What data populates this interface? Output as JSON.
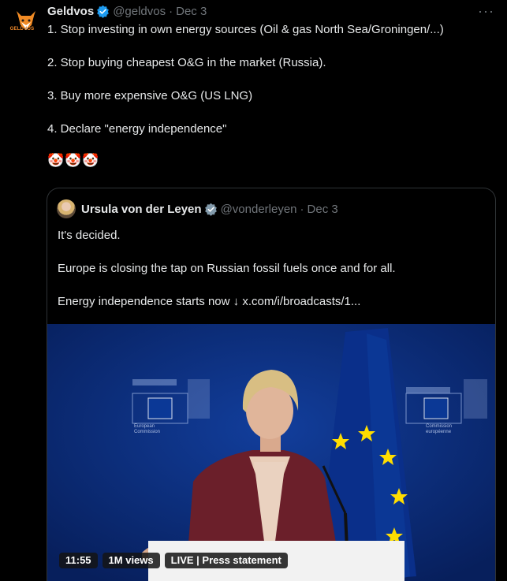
{
  "tweet": {
    "author_name": "Geldvos",
    "handle": "@geldvos",
    "separator": "·",
    "date": "Dec 3",
    "avatar_label": "GELDVOS",
    "more_label": "···",
    "lines": [
      "1. Stop investing in own energy sources (Oil & gas North Sea/Groningen/...)",
      "2. Stop buying cheapest O&G in the market (Russia).",
      "3. Buy more expensive O&G (US LNG)",
      "4. Declare \"energy independence\"",
      "🤡🤡🤡"
    ]
  },
  "quoted": {
    "author_name": "Ursula von der Leyen",
    "handle": "@vonderleyen",
    "separator": "·",
    "date": "Dec 3",
    "lines": [
      "It's decided.",
      "Europe is closing the tap on Russian fossil fuels once and for all."
    ],
    "last_line_prefix": "Energy independence starts now ↓ ",
    "link_text": "x.com/i/broadcasts/1..."
  },
  "video": {
    "duration": "11:55",
    "views": "1M views",
    "status": "LIVE | Press statement",
    "left_logo_text": "European\nCommission",
    "right_logo_text": "Commission\neuropéenne"
  },
  "colors": {
    "background": "#000000",
    "text": "#e7e9ea",
    "muted": "#71767b",
    "verified_blue": "#1d9bf0",
    "verified_gray": "#829aab",
    "eu_blue": "#0b3a9a",
    "eu_star": "#ffdd00",
    "jacket": "#6b1f2a"
  }
}
